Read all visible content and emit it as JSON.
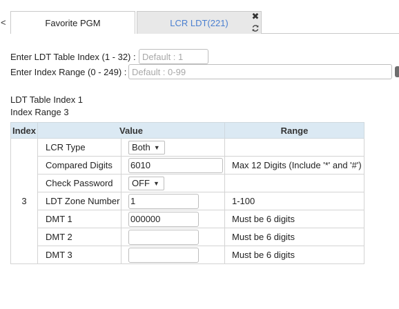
{
  "tabs": {
    "scroll_left_glyph": "<",
    "items": [
      {
        "label": "Favorite PGM",
        "active": false
      },
      {
        "label": "LCR LDT(221)",
        "active": true
      }
    ],
    "close_glyph": "✖",
    "refresh_icon": "refresh-icon",
    "active_color": "#4a7fd0"
  },
  "form": {
    "table_index_label": "Enter LDT Table Index (1 - 32) :",
    "table_index_placeholder": "Default : 1",
    "index_range_label": "Enter Index Range (0 - 249) :",
    "index_range_placeholder": "Default : 0-99"
  },
  "info": {
    "table_index": "LDT Table Index 1",
    "index_range": "Index Range 3"
  },
  "table": {
    "headers": [
      "Index",
      "Value",
      "Range"
    ],
    "header_color": "#dbe9f3",
    "index_value": "3",
    "rows": [
      {
        "name": "LCR Type",
        "type": "select",
        "value": "Both",
        "range": ""
      },
      {
        "name": "Compared Digits",
        "type": "input",
        "value": "6010",
        "range": "Max 12 Digits (Include '*' and '#')"
      },
      {
        "name": "Check Password",
        "type": "select",
        "value": "OFF",
        "range": ""
      },
      {
        "name": "LDT Zone Number",
        "type": "input",
        "value": "1",
        "range": "1-100"
      },
      {
        "name": "DMT 1",
        "type": "input",
        "value": "000000",
        "range": "Must be 6 digits"
      },
      {
        "name": "DMT 2",
        "type": "input",
        "value": "",
        "range": "Must be 6 digits"
      },
      {
        "name": "DMT 3",
        "type": "input",
        "value": "",
        "range": "Must be 6 digits"
      }
    ]
  }
}
